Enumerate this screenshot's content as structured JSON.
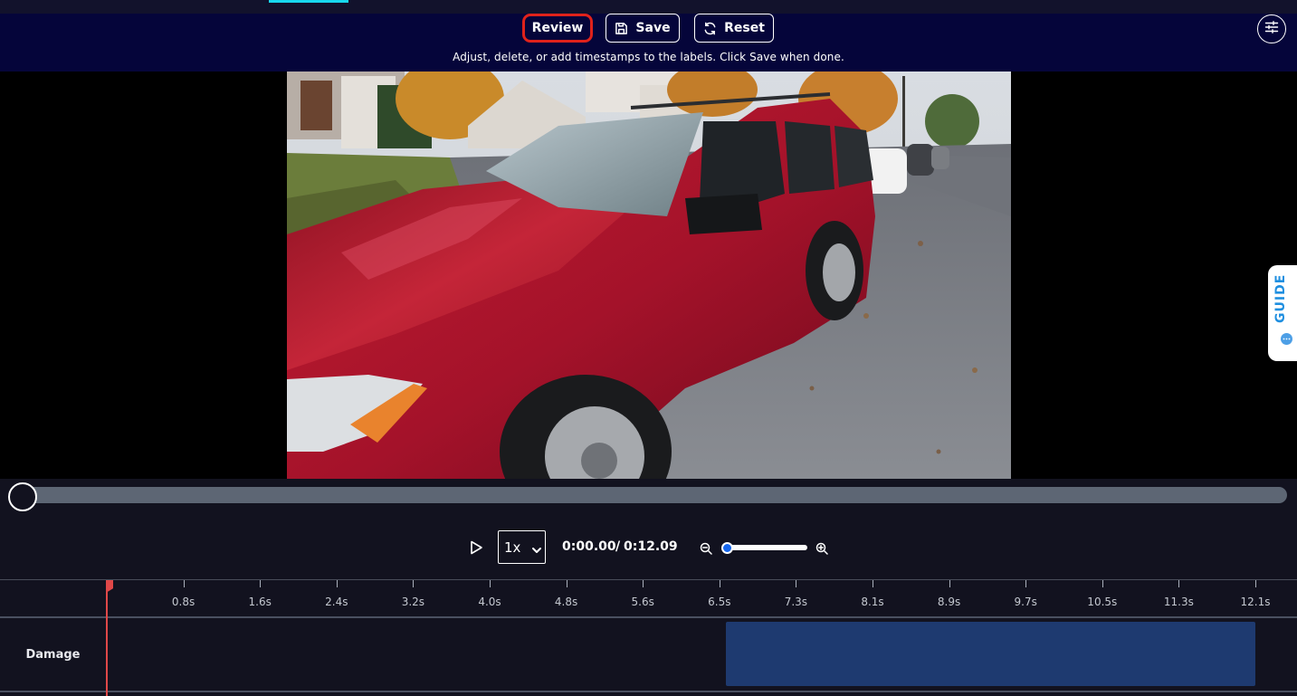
{
  "toolbar": {
    "review_label": "Review",
    "save_label": "Save",
    "reset_label": "Reset",
    "instructions": "Adjust, delete, or add timestamps to the labels. Click Save when done."
  },
  "guide": {
    "label": "GUIDE"
  },
  "player": {
    "speed": "1x",
    "current_time": "0:00.00",
    "separator": "/",
    "total_time": "0:12.09",
    "progress": 0.0,
    "zoom_level": 0.0
  },
  "timeline": {
    "ticks": [
      "0.8s",
      "1.6s",
      "2.4s",
      "3.2s",
      "4.0s",
      "4.8s",
      "5.6s",
      "6.5s",
      "7.3s",
      "8.1s",
      "8.9s",
      "9.7s",
      "10.5s",
      "11.3s",
      "12.1s"
    ],
    "tracks": [
      {
        "label": "Damage",
        "segments": [
          {
            "start_s": 6.52,
            "end_s": 12.09
          }
        ]
      }
    ]
  },
  "colors": {
    "toolbar_bg": "#05053a",
    "review_highlight": "#e0221b",
    "segment": "#1e3a70",
    "playhead": "#e04848",
    "accent_tab": "#18d7ee",
    "guide_text": "#1f8fe0"
  },
  "icons": {
    "save": "floppy-disk-icon",
    "reset": "refresh-icon",
    "settings": "sliders-icon",
    "play": "play-icon",
    "zoom_out": "zoom-out-icon",
    "zoom_in": "zoom-in-icon"
  }
}
